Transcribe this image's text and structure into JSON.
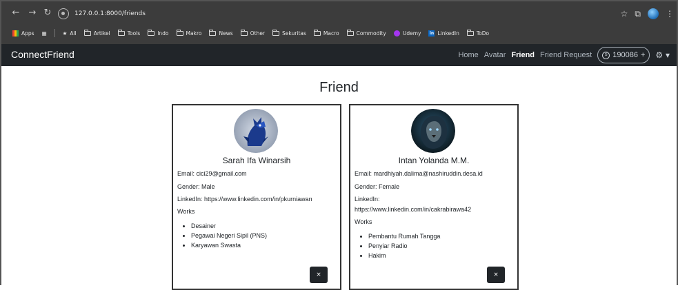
{
  "browser": {
    "url": "127.0.0.1:8000/friends",
    "bookmarks": [
      "Apps",
      "All",
      "Artikel",
      "Tools",
      "Indo",
      "Makro",
      "News",
      "Other",
      "Sekuritas",
      "Macro",
      "Commodity",
      "Udemy",
      "LinkedIn",
      "ToDo"
    ]
  },
  "navbar": {
    "brand": "ConnectFriend",
    "links": [
      "Home",
      "Avatar",
      "Friend",
      "Friend Request"
    ],
    "active": "Friend",
    "coins": "190086",
    "coin_symbol": "$",
    "plus": "+"
  },
  "page": {
    "title": "Friend"
  },
  "friends": [
    {
      "name": "Sarah Ifa Winarsih",
      "email": "Email: cici29@gmail.com",
      "gender": "Gender: Male",
      "linkedin": "LinkedIn: https://www.linkedin.com/in/pkurniawan",
      "works_label": "Works",
      "works": [
        "Desainer",
        "Pegawai Negeri Sipil (PNS)",
        "Karyawan Swasta"
      ],
      "close": "×"
    },
    {
      "name": "Intan Yolanda M.M.",
      "email": "Email: mardhiyah.dalima@nashiruddin.desa.id",
      "gender": "Gender: Female",
      "linkedin_label": "LinkedIn:",
      "linkedin_url": "https://www.linkedin.com/in/cakrabirawa42",
      "works_label": "Works",
      "works": [
        "Pembantu Rumah Tangga",
        "Penyiar Radio",
        "Hakim"
      ],
      "close": "×"
    }
  ]
}
